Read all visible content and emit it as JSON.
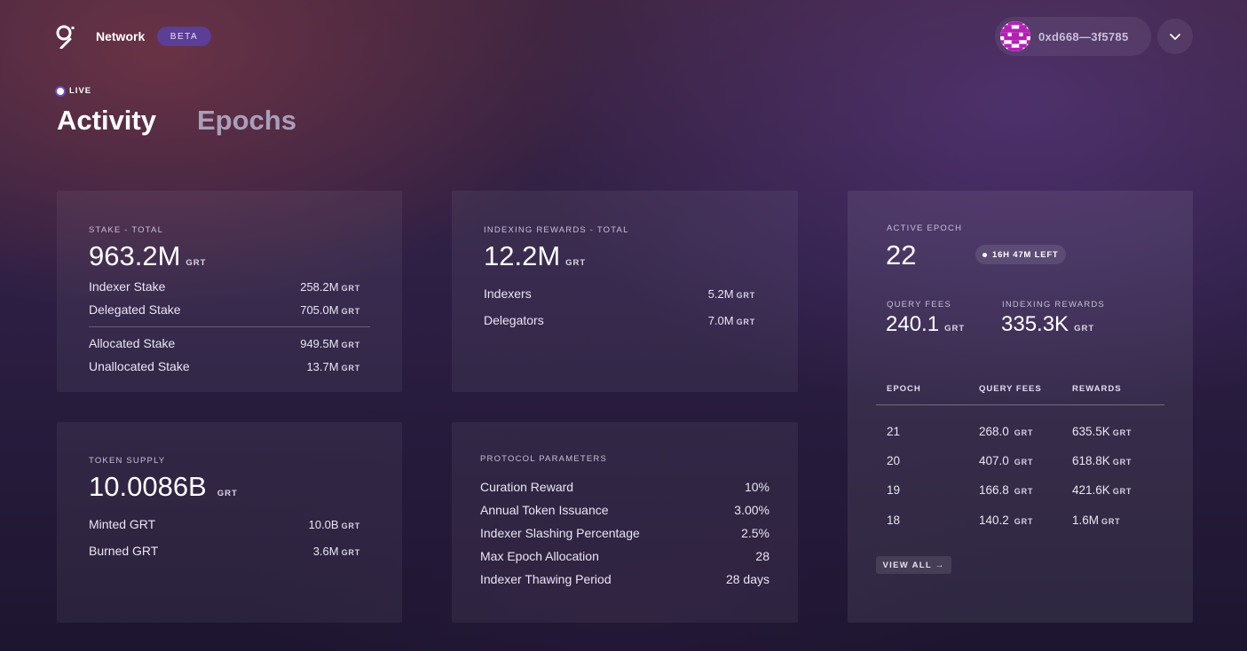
{
  "header": {
    "brand": "Network",
    "badge": "BETA",
    "account_address": "0xd668—3f5785",
    "logo_icon": "the-graph-logo-icon",
    "menu_icon": "chevron-down-icon"
  },
  "status": {
    "live_label": "LIVE"
  },
  "tabs": {
    "activity": "Activity",
    "epochs": "Epochs"
  },
  "stake": {
    "label": "STAKE - TOTAL",
    "total": "963.2M",
    "unit": "GRT",
    "rows": [
      {
        "label": "Indexer Stake",
        "value": "258.2M",
        "unit": "GRT"
      },
      {
        "label": "Delegated Stake",
        "value": "705.0M",
        "unit": "GRT"
      },
      {
        "label": "Allocated Stake",
        "value": "949.5M",
        "unit": "GRT"
      },
      {
        "label": "Unallocated Stake",
        "value": "13.7M",
        "unit": "GRT"
      }
    ]
  },
  "indexing_rewards": {
    "label": "INDEXING REWARDS - TOTAL",
    "total": "12.2M",
    "unit": "GRT",
    "rows": [
      {
        "label": "Indexers",
        "value": "5.2M",
        "unit": "GRT"
      },
      {
        "label": "Delegators",
        "value": "7.0M",
        "unit": "GRT"
      }
    ]
  },
  "token_supply": {
    "label": "TOKEN SUPPLY",
    "total": "10.0086B",
    "unit": "GRT",
    "rows": [
      {
        "label": "Minted GRT",
        "value": "10.0B",
        "unit": "GRT"
      },
      {
        "label": "Burned GRT",
        "value": "3.6M",
        "unit": "GRT"
      }
    ]
  },
  "protocol_parameters": {
    "label": "PROTOCOL PARAMETERS",
    "rows": [
      {
        "label": "Curation Reward",
        "value": "10%"
      },
      {
        "label": "Annual Token Issuance",
        "value": "3.00%"
      },
      {
        "label": "Indexer Slashing Percentage",
        "value": "2.5%"
      },
      {
        "label": "Max Epoch Allocation",
        "value": "28"
      },
      {
        "label": "Indexer Thawing Period",
        "value": "28 days"
      }
    ]
  },
  "active_epoch": {
    "label": "ACTIVE EPOCH",
    "value": "22",
    "time_left": "16H 47M LEFT",
    "query_fees_label": "QUERY FEES",
    "query_fees": "240.1",
    "query_fees_unit": "GRT",
    "indexing_rewards_label": "INDEXING REWARDS",
    "indexing_rewards": "335.3K",
    "indexing_rewards_unit": "GRT",
    "table": {
      "headers": [
        "EPOCH",
        "QUERY FEES",
        "REWARDS"
      ],
      "rows": [
        {
          "epoch": "21",
          "query_fees": "268.0",
          "rewards": "635.5K",
          "unit": "GRT"
        },
        {
          "epoch": "20",
          "query_fees": "407.0",
          "rewards": "618.8K",
          "unit": "GRT"
        },
        {
          "epoch": "19",
          "query_fees": "166.8",
          "rewards": "421.6K",
          "unit": "GRT"
        },
        {
          "epoch": "18",
          "query_fees": "140.2",
          "rewards": "1.6M",
          "unit": "GRT"
        }
      ]
    },
    "view_all": "VIEW ALL →"
  }
}
